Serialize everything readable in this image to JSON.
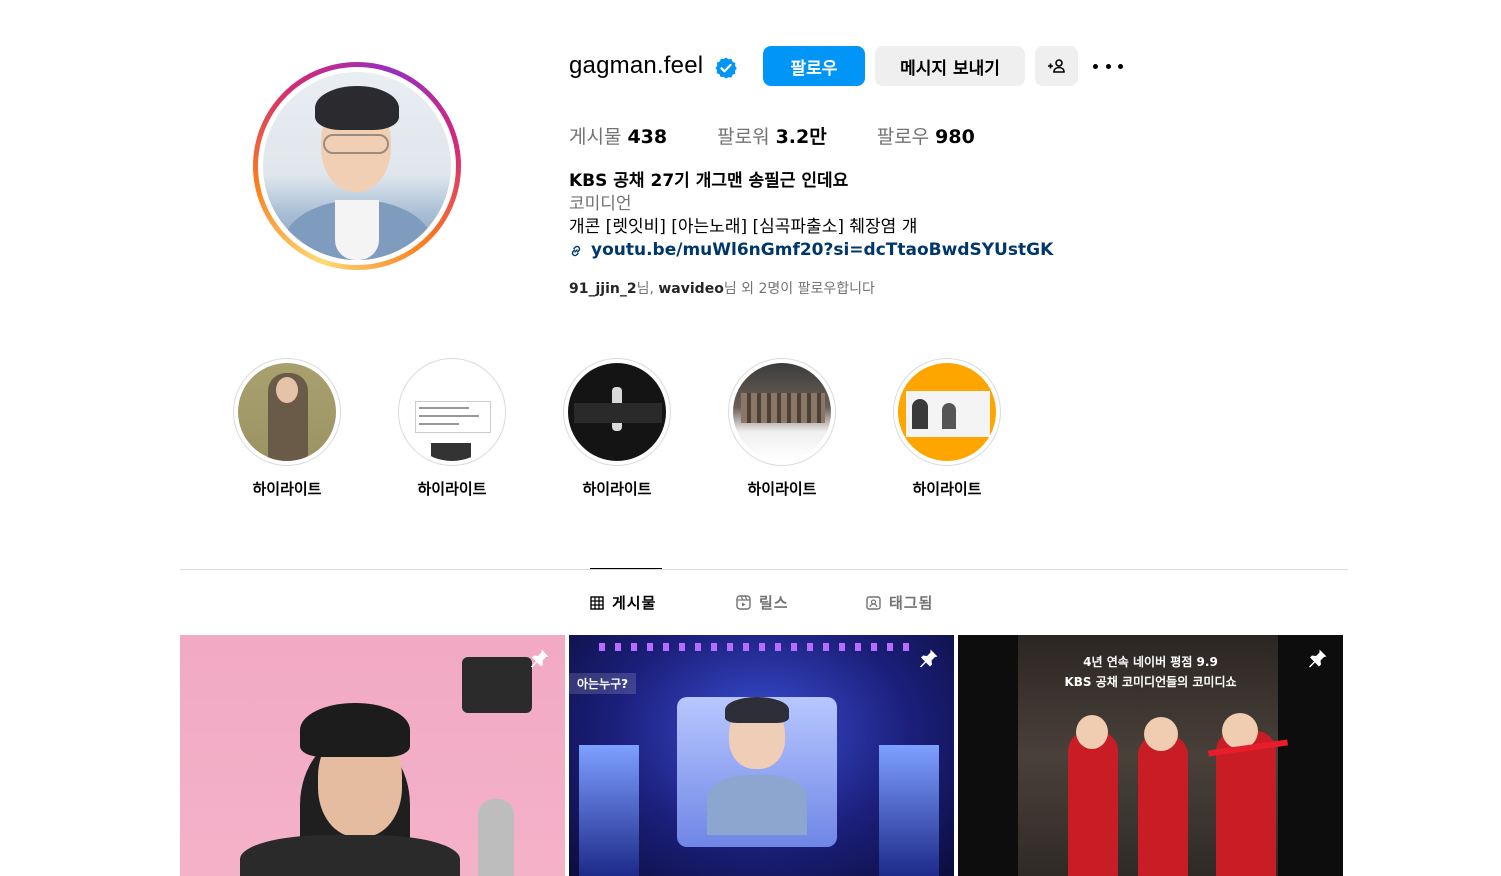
{
  "profile": {
    "username": "gagman.feel",
    "verified": true,
    "follow_label": "팔로우",
    "message_label": "메시지 보내기",
    "suggest_label": "+⍝",
    "stats": [
      {
        "label": "게시물",
        "value": "438"
      },
      {
        "label": "팔로워",
        "value": "3.2만"
      },
      {
        "label": "팔로우",
        "value": "980"
      }
    ],
    "bio": {
      "name": "KBS 공채 27기 개그맨 송필근 인데요",
      "category": "코미디언",
      "line": "개콘 [렛잇비] [아는노래] [심곡파출소] 췌장염 걔",
      "link": "youtu.be/muWl6nGmf20?si=dcTtaoBwdSYUstGK"
    },
    "followed_by": {
      "user1": "91_jjin_2",
      "sep1": "님, ",
      "user2": "wavideo",
      "suffix": "님 외 2명이 팔로우합니다"
    }
  },
  "highlights": [
    {
      "label": "하이라이트"
    },
    {
      "label": "하이라이트"
    },
    {
      "label": "하이라이트"
    },
    {
      "label": "하이라이트"
    },
    {
      "label": "하이라이트"
    }
  ],
  "tabs": [
    {
      "label": "게시물",
      "active": true
    },
    {
      "label": "릴스",
      "active": false
    },
    {
      "label": "태그됨",
      "active": false
    }
  ],
  "posts": [
    {
      "pinned": true,
      "overlay_text": ""
    },
    {
      "pinned": true,
      "overlay_text": "아는누구?"
    },
    {
      "pinned": true,
      "overlay_text": "4년 연속 네이버 평점 9.9",
      "overlay_text2": "KBS 공채 코미디언들의 코미디쇼"
    }
  ],
  "colors": {
    "accent": "#0095f6",
    "secondary_button": "#efefef",
    "muted_text": "#737373",
    "link": "#00376b",
    "verified_badge": "#0095f6"
  },
  "icons": {
    "verified": "verified-badge-icon",
    "more": "more-options-icon",
    "link": "link-icon",
    "posts_tab": "grid-icon",
    "reels_tab": "reels-icon",
    "tagged_tab": "tagged-icon",
    "pin": "pin-icon"
  }
}
